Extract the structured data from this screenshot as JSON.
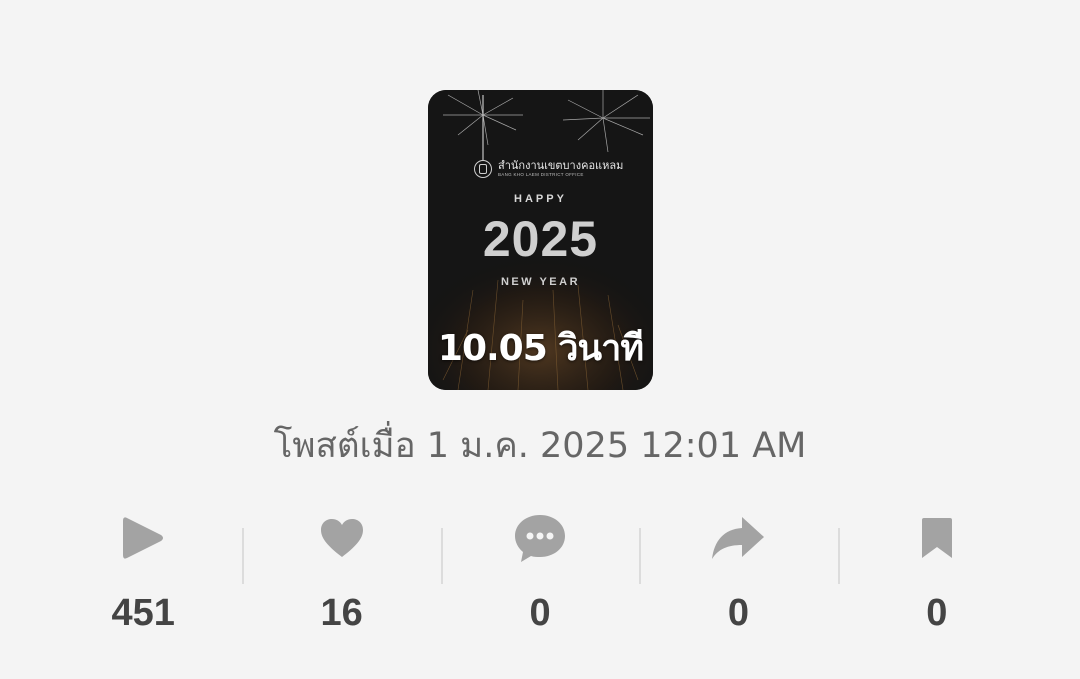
{
  "video": {
    "organization_th": "สำนักงานเขตบางคอแหลม",
    "organization_en": "BANG KHO LAEM DISTRICT OFFICE",
    "greeting_top": "HAPPY",
    "greeting_year": "2025",
    "greeting_bottom": "NEW YEAR",
    "duration": "10.05 วินาที"
  },
  "posted_label": "โพสต์เมื่อ 1 ม.ค. 2025 12:01 AM",
  "stats": [
    {
      "icon": "play-icon",
      "value": "451"
    },
    {
      "icon": "heart-icon",
      "value": "16"
    },
    {
      "icon": "comment-icon",
      "value": "0"
    },
    {
      "icon": "share-icon",
      "value": "0"
    },
    {
      "icon": "bookmark-icon",
      "value": "0"
    }
  ],
  "colors": {
    "background": "#f4f4f4",
    "icon": "#a3a3a3",
    "count_text": "#444444",
    "posted_text": "#666666"
  }
}
